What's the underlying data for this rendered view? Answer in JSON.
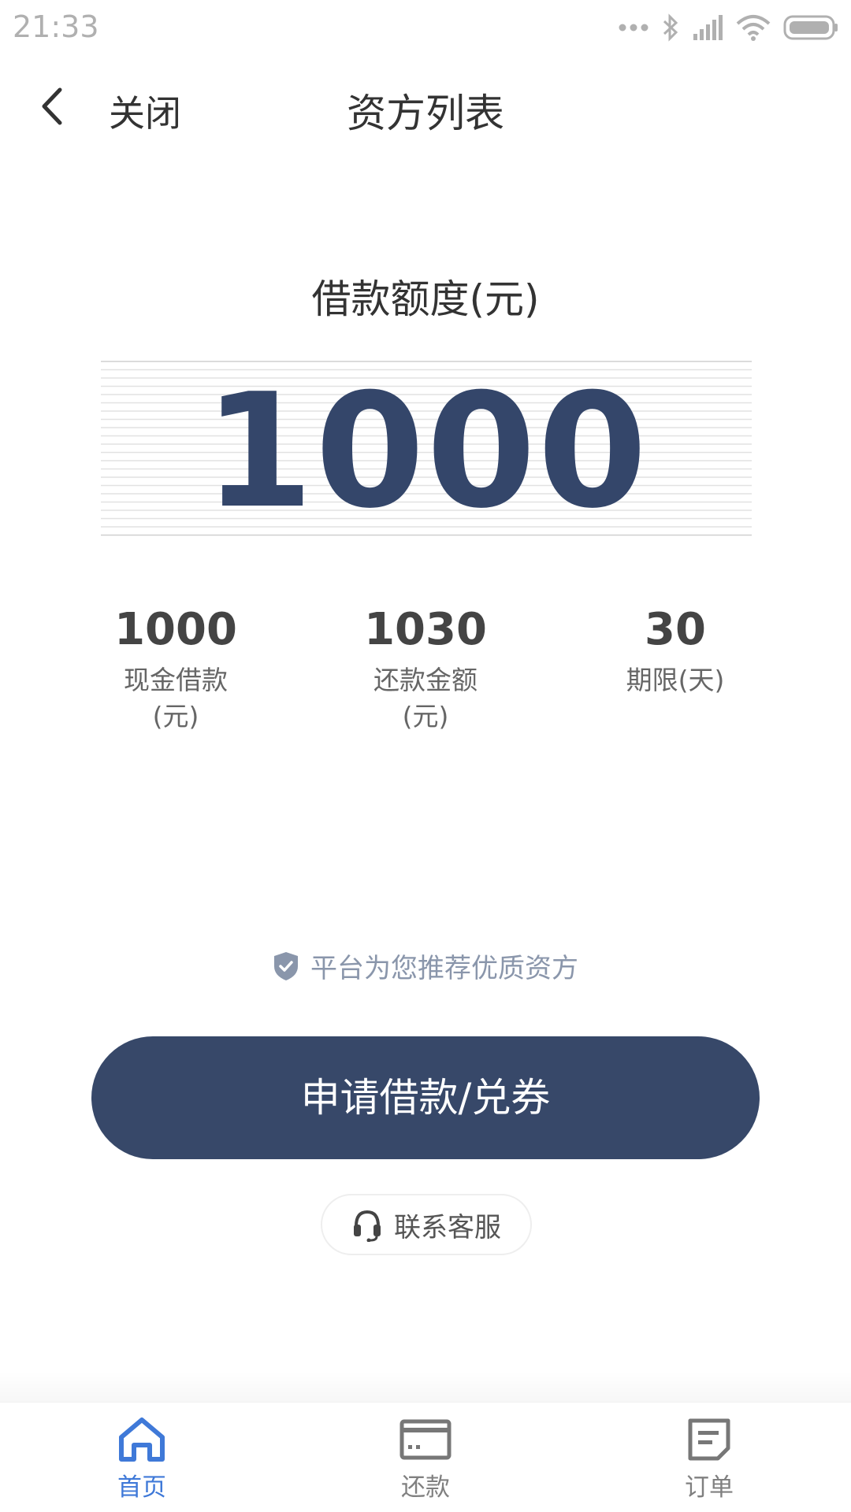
{
  "status_bar": {
    "time": "21:33"
  },
  "nav": {
    "close_label": "关闭",
    "title": "资方列表"
  },
  "amount": {
    "label": "借款额度(元)",
    "value": "1000"
  },
  "stats": [
    {
      "value": "1000",
      "label_line1": "现金借款",
      "label_line2": "(元)"
    },
    {
      "value": "1030",
      "label_line1": "还款金额",
      "label_line2": "(元)"
    },
    {
      "value": "30",
      "label_line1": "期限(天)",
      "label_line2": ""
    }
  ],
  "recommend_text": "平台为您推荐优质资方",
  "apply_button_label": "申请借款/兑券",
  "contact_label": "联系客服",
  "tabs": [
    {
      "label": "首页",
      "icon": "home-icon",
      "active": true
    },
    {
      "label": "还款",
      "icon": "card-icon",
      "active": false
    },
    {
      "label": "订单",
      "icon": "document-icon",
      "active": false
    }
  ],
  "colors": {
    "primary": "#374869",
    "amount_text": "#34466a",
    "active_tab": "#3f79d8",
    "muted_text": "#8a96ab"
  }
}
